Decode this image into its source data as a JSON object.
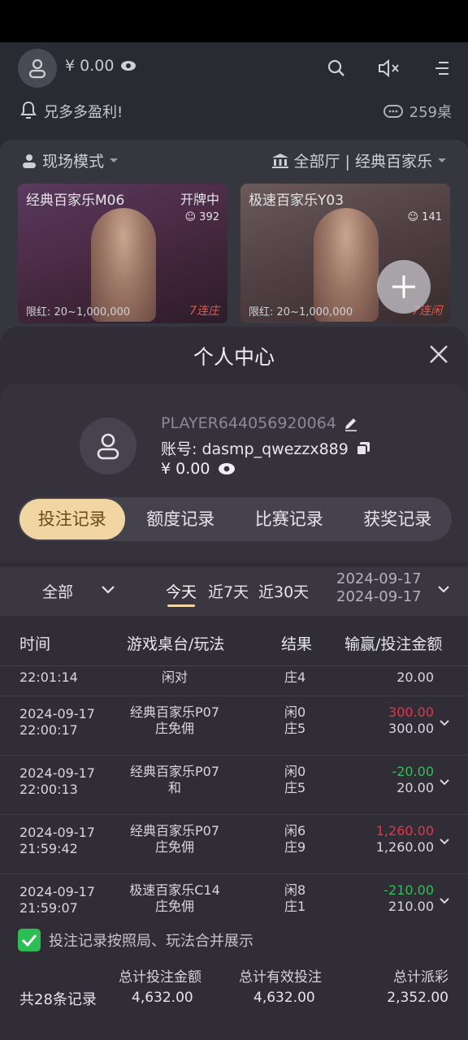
{
  "header": {
    "balance": "¥ 0.00",
    "notice": "兄多多盈利!",
    "table_count": "259桌"
  },
  "lobby": {
    "mode_label": "现场模式",
    "hall_label": "全部厅 | 经典百家乐",
    "tiles": [
      {
        "title": "经典百家乐M06",
        "status": "开牌中",
        "viewers": "392",
        "limit": "限红: 20~1,000,000",
        "streak": "7连庄"
      },
      {
        "title": "极速百家乐Y03",
        "status": "",
        "viewers": "141",
        "limit": "限红: 20~1,000,000",
        "streak": "7连闲"
      }
    ]
  },
  "modal": {
    "title": "个人中心",
    "profile": {
      "player_name": "PLAYER644056920064",
      "account": "账号: dasmp_qwezzx889",
      "balance": "¥ 0.00"
    },
    "tabs": [
      "投注记录",
      "额度记录",
      "比赛记录",
      "获奖记录"
    ],
    "active_tab": 0,
    "filter": {
      "type": "全部",
      "periods": [
        "今天",
        "近7天",
        "近30天"
      ],
      "active_period": 0,
      "date_from": "2024-09-17",
      "date_to": "2024-09-17"
    },
    "columns": [
      "时间",
      "游戏桌台/玩法",
      "结果",
      "输赢/投注金额"
    ],
    "partial_row": {
      "time": "22:01:14",
      "game": "闲对",
      "result": "庄4",
      "bet": "20.00"
    },
    "records": [
      {
        "date": "2024-09-17",
        "time": "22:00:17",
        "game": "经典百家乐P07",
        "play": "庄免佣",
        "res1": "闲0",
        "res2": "庄5",
        "winloss": "300.00",
        "wl_class": "loss",
        "bet": "300.00"
      },
      {
        "date": "2024-09-17",
        "time": "22:00:13",
        "game": "经典百家乐P07",
        "play": "和",
        "res1": "闲0",
        "res2": "庄5",
        "winloss": "-20.00",
        "wl_class": "win",
        "bet": "20.00"
      },
      {
        "date": "2024-09-17",
        "time": "21:59:42",
        "game": "经典百家乐P07",
        "play": "庄免佣",
        "res1": "闲6",
        "res2": "庄9",
        "winloss": "1,260.00",
        "wl_class": "loss",
        "bet": "1,260.00"
      },
      {
        "date": "2024-09-17",
        "time": "21:59:07",
        "game": "极速百家乐C14",
        "play": "庄免佣",
        "res1": "闲8",
        "res2": "庄1",
        "winloss": "-210.00",
        "wl_class": "win",
        "bet": "210.00"
      }
    ],
    "merge_label": "投注记录按照局、玩法合并展示",
    "merge_checked": true,
    "summary": {
      "count": "共28条记录",
      "total_bet_label": "总计投注金额",
      "total_bet": "4,632.00",
      "valid_bet_label": "总计有效投注",
      "valid_bet": "4,632.00",
      "payout_label": "总计派彩",
      "payout": "2,352.00"
    },
    "colors": {
      "accent": "#f1d6a4",
      "win_green": "#2fbf55",
      "loss_red": "#e2374a",
      "check": "#2dbd55"
    }
  }
}
